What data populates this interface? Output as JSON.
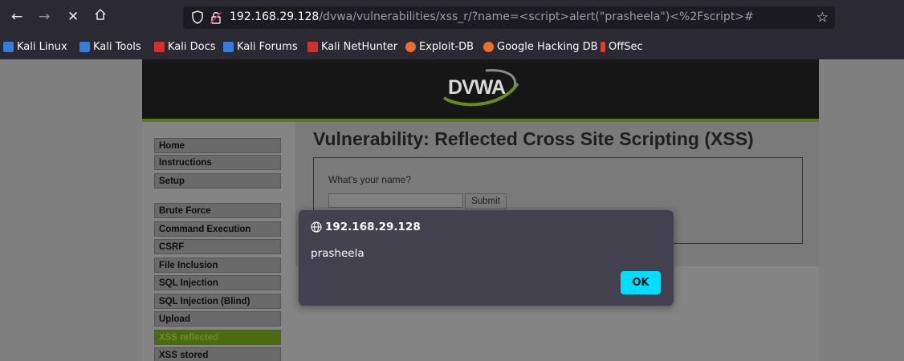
{
  "browser": {
    "url_host": "192.168.29.128",
    "url_path": "/dvwa/vulnerabilities/xss_r/?name=<script>alert(\"prasheela\")<%2Fscript>#",
    "nav_icons": [
      "back-arrow-icon",
      "forward-arrow-icon",
      "stop-icon",
      "home-icon"
    ]
  },
  "bookmarks": [
    {
      "label": "Kali Linux",
      "icon_color": "#3a7bd5"
    },
    {
      "label": "Kali Tools",
      "icon_color": "#3a7bd5"
    },
    {
      "label": "Kali Docs",
      "icon_color": "#d32f2f"
    },
    {
      "label": "Kali Forums",
      "icon_color": "#3a7bd5"
    },
    {
      "label": "Kali NetHunter",
      "icon_color": "#d32f2f"
    },
    {
      "label": "Exploit-DB",
      "icon_color": "#e8702a"
    },
    {
      "label": "Google Hacking DB",
      "icon_color": "#e8702a"
    },
    {
      "label": "OffSec",
      "icon_color": "#e53935"
    }
  ],
  "dvwa": {
    "logo": "DVWA",
    "menu": [
      {
        "label": "Home"
      },
      {
        "label": "Instructions"
      },
      {
        "label": "Setup"
      },
      {
        "label": "Brute Force"
      },
      {
        "label": "Command Execution"
      },
      {
        "label": "CSRF"
      },
      {
        "label": "File Inclusion"
      },
      {
        "label": "SQL Injection"
      },
      {
        "label": "SQL Injection (Blind)"
      },
      {
        "label": "Upload"
      },
      {
        "label": "XSS reflected"
      },
      {
        "label": "XSS stored"
      }
    ],
    "active_menu": "XSS reflected",
    "title": "Vulnerability: Reflected Cross Site Scripting (XSS)",
    "question": "What's your name?",
    "input_value": "",
    "submit_label": "Submit"
  },
  "alert": {
    "origin": "192.168.29.128",
    "message": "prasheela",
    "ok_label": "OK",
    "ok_color": "#00ddff"
  }
}
